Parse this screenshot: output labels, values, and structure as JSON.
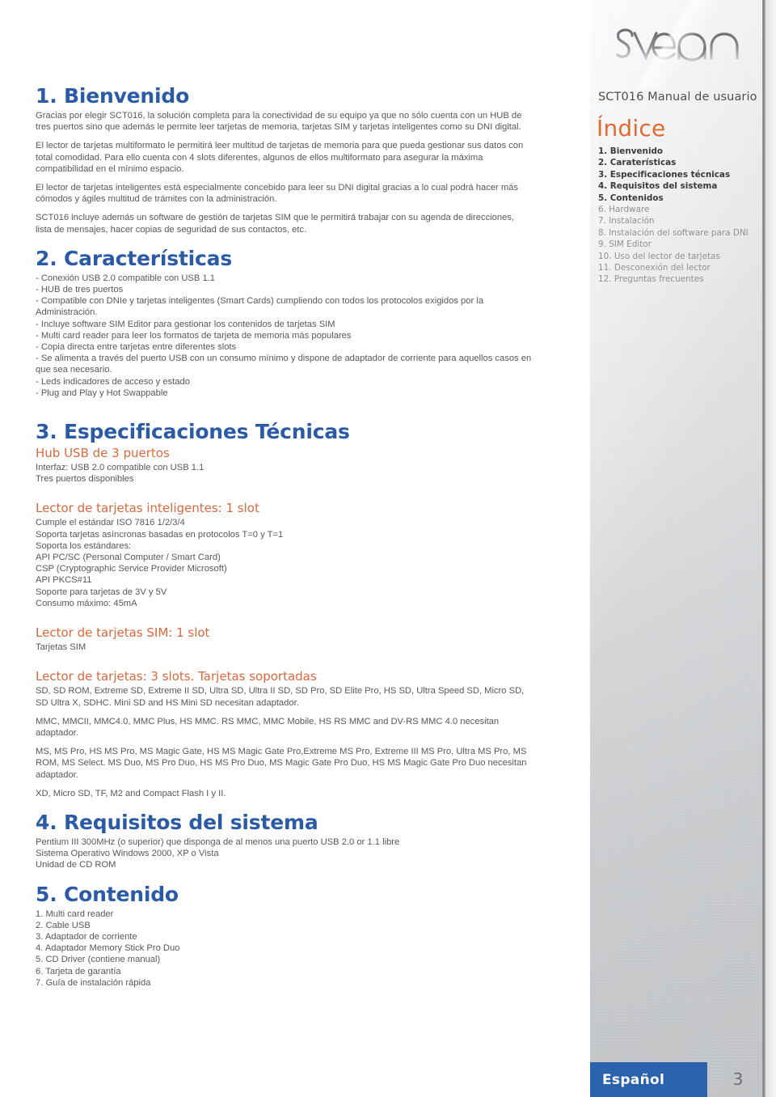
{
  "brand": {
    "logo_text": "sveon",
    "logo_name": "sveon-logo"
  },
  "sidebar": {
    "manual_title": "SCT016 Manual de usuario",
    "index_heading": "Índice",
    "index_items": [
      {
        "label": "1. Bienvenido",
        "emphasis": "strong"
      },
      {
        "label": "2. Caraterísticas",
        "emphasis": "strong"
      },
      {
        "label": "3. Especificaciones técnicas",
        "emphasis": "strong"
      },
      {
        "label": "4. Requisitos del sistema",
        "emphasis": "strong"
      },
      {
        "label": "5. Contenidos",
        "emphasis": "strong"
      },
      {
        "label": "6. Hardware",
        "emphasis": "light"
      },
      {
        "label": "7. Instalación",
        "emphasis": "light"
      },
      {
        "label": "8. Instalación del software para DNI",
        "emphasis": "light"
      },
      {
        "label": "9. SIM Editor",
        "emphasis": "light"
      },
      {
        "label": "10. Uso del lector de tarjetas",
        "emphasis": "light"
      },
      {
        "label": "11. Desconexión del lector",
        "emphasis": "light"
      },
      {
        "label": "12. Preguntas frecuentes",
        "emphasis": "light"
      }
    ]
  },
  "footer": {
    "language_badge": "Español",
    "page_number": "3"
  },
  "colors": {
    "heading_blue": "#2b5ba4",
    "subheading_orange": "#d9693c",
    "body_gray": "#57585a",
    "badge_blue": "#2b62ad"
  },
  "sections": {
    "welcome": {
      "heading": "1. Bienvenido",
      "p1": "Gracias por elegir SCT016, la solución completa para la conectividad de su equipo ya que no sólo cuenta con un HUB de tres puertos sino que además le permite leer tarjetas de memoria, tarjetas SIM y tarjetas inteligentes como su DNI digital.",
      "p2": "El lector de tarjetas multiformato le permitirá leer multitud de tarjetas de memoria para que pueda gestionar sus datos con total comodidad. Para ello cuenta con 4 slots diferentes, algunos de ellos multiformato para asegurar la máxima compatibilidad en el mínimo espacio.",
      "p3": "El lector de tarjetas inteligentes está especialmente concebido para leer su DNI digital gracias a lo cual podrá hacer más cómodos y ágiles multitud de trámites con la administración.",
      "p4": "SCT016 incluye además un software de gestión de tarjetas SIM que le permitirá trabajar con su agenda de direcciones, lista de mensajes, hacer copias de seguridad de sus contactos, etc."
    },
    "features": {
      "heading": "2. Características",
      "items": [
        "- Conexión USB 2.0 compatible con USB 1.1",
        "- HUB de tres puertos",
        "- Compatible con DNIe y tarjetas inteligentes (Smart Cards) cumpliendo con todos los protocolos exigidos por la Administración.",
        "- Incluye software SIM Editor para gestionar los contenidos de tarjetas SIM",
        "- Multi card reader para leer los formatos de tarjeta de memoria más populares",
        "- Copia directa entre tarjetas entre diferentes slots",
        "- Se alimenta a través del puerto USB con un consumo mínimo y dispone de adaptador de corriente para aquellos casos en que sea necesario.",
        "- Leds indicadores de acceso y estado",
        "- Plug and Play y Hot Swappable"
      ]
    },
    "specs": {
      "heading": "3. Especificaciones Técnicas",
      "hub": {
        "sub": "Hub USB de 3 puertos",
        "lines": [
          "Interfaz: USB 2.0 compatible con USB 1.1",
          "Tres puertos disponibles"
        ]
      },
      "smart": {
        "sub": "Lector de tarjetas inteligentes: 1 slot",
        "lines": [
          "Cumple el estándar ISO 7816 1/2/3/4",
          "Soporta tarjetas asíncronas basadas en protocolos T=0 y T=1",
          "Soporta los estándares:",
          "API PC/SC (Personal Computer / Smart Card)",
          "CSP (Cryptographic Service Provider Microsoft)",
          "API PKCS#11",
          "Soporte para tarjetas de 3V y 5V",
          "Consumo máximo: 45mA"
        ]
      },
      "sim": {
        "sub": "Lector de tarjetas SIM: 1 slot",
        "lines": [
          "Tarjetas SIM"
        ]
      },
      "cards": {
        "sub": "Lector de tarjetas: 3 slots. Tarjetas soportadas",
        "p1": "SD, SD ROM, Extreme SD, Extreme II SD, Ultra SD, Ultra II SD, SD Pro, SD Elite Pro, HS SD, Ultra Speed SD, Micro SD, SD Ultra X, SDHC. Mini SD and HS Mini SD necesitan adaptador.",
        "p2": "MMC, MMCII, MMC4.0, MMC Plus, HS MMC. RS MMC, MMC Mobile, HS RS MMC and DV-RS MMC 4.0 necesitan adaptador.",
        "p3": "MS, MS Pro, HS MS Pro, MS Magic Gate, HS MS Magic Gate Pro,Extreme MS Pro, Extreme III MS Pro, Ultra MS Pro, MS ROM, MS Select.  MS Duo, MS Pro Duo, HS MS Pro Duo, MS Magic Gate Pro Duo, HS MS Magic Gate Pro Duo necesitan adaptador.",
        "p4": "XD, Micro SD, TF, M2 and Compact Flash I y II."
      }
    },
    "requirements": {
      "heading": "4. Requisitos del sistema",
      "lines": [
        "Pentium III 300MHz (o superior) que disponga de al menos una puerto USB 2.0 or 1.1 libre",
        "Sistema Operativo Windows 2000, XP o Vista",
        "Unidad de CD ROM"
      ]
    },
    "contents": {
      "heading": "5. Contenido",
      "items": [
        "1. Multi card reader",
        "2. Cable USB",
        "3. Adaptador de corriente",
        "4. Adaptador Memory Stick Pro Duo",
        "5. CD Driver (contiene manual)",
        "6. Tarjeta de garantía",
        "7. Guía de instalación rápida"
      ]
    }
  }
}
